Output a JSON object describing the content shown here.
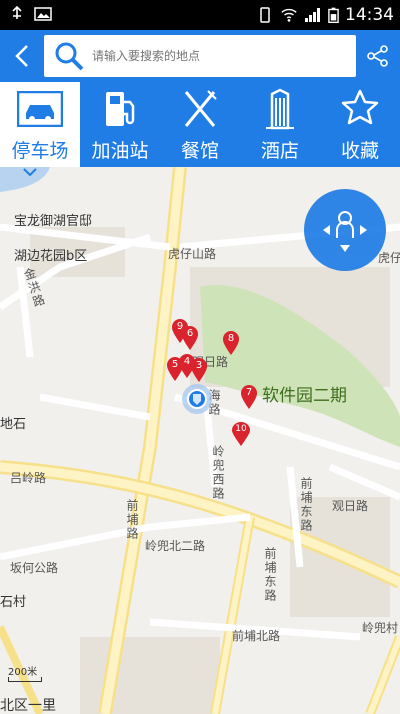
{
  "status_bar": {
    "time": "14:34"
  },
  "search": {
    "placeholder": "请输入要搜索的地点"
  },
  "categories": [
    {
      "label": "停车场",
      "icon": "car-icon"
    },
    {
      "label": "加油站",
      "icon": "gas-pump-icon"
    },
    {
      "label": "餐馆",
      "icon": "fork-knife-icon"
    },
    {
      "label": "酒店",
      "icon": "building-icon"
    },
    {
      "label": "收藏",
      "icon": "star-icon"
    }
  ],
  "map": {
    "places": [
      "宝龙御湖官邸",
      "湖边花园b区",
      "软件园二期",
      "地石",
      "石村"
    ],
    "roads": [
      "虎仔山路",
      "金洪路",
      "观日路",
      "前埔路",
      "吕岭路",
      "岭兜西路",
      "前埔东路",
      "观日路",
      "岭兜北二路",
      "坂何公路",
      "前埔东路",
      "前埔北路",
      "岭兜村",
      "北区一里",
      "虎仔",
      "海路"
    ],
    "markers": [
      "9",
      "6",
      "8",
      "5",
      "4",
      "3",
      "7",
      "10"
    ],
    "scale_label": "200米"
  },
  "colors": {
    "accent": "#1f7de5",
    "marker": "#d9232d",
    "park": "#cfe3b8"
  }
}
